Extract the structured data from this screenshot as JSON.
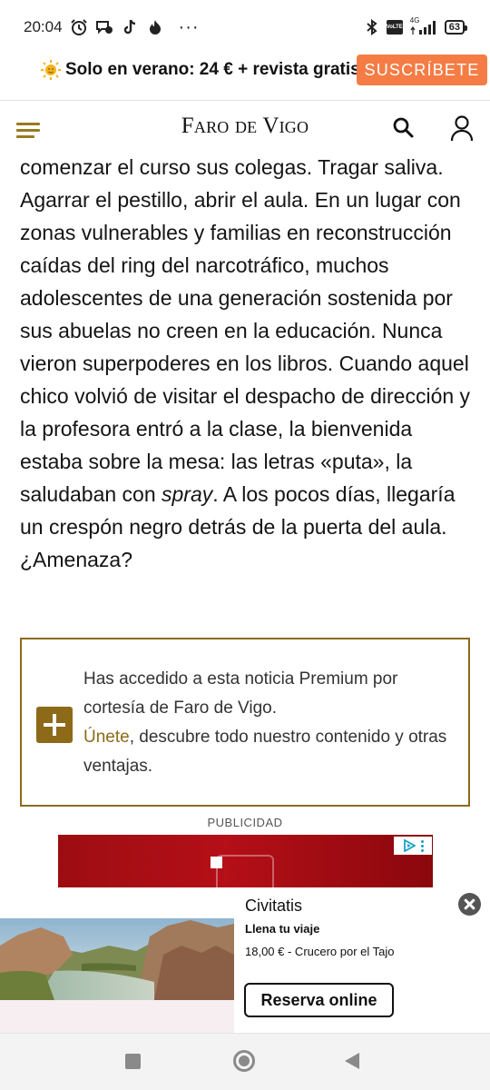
{
  "status_bar": {
    "time": "20:04",
    "battery": "63",
    "network": "4G",
    "volte": "VoLTE",
    "more": "···",
    "icons": [
      "alarm-icon",
      "chat-icon",
      "tiktok-icon",
      "flame-icon",
      "bluetooth-icon",
      "volte-icon",
      "signal-icon",
      "battery-icon"
    ]
  },
  "promo": {
    "icon": "sun-icon",
    "text": "Solo en verano: 24 € + revista gratis",
    "subscribe_label": "SUSCRÍBETE",
    "accent": "#f57c45"
  },
  "header": {
    "brand_first": "Faro",
    "brand_second": "de Vigo",
    "menu_icon": "hamburger-menu-icon",
    "search_icon": "search-icon",
    "user_icon": "user-icon",
    "accent": "#9a7a1f"
  },
  "article": {
    "text_before": "comenzar el curso sus colegas. Tragar saliva. Agarrar el pestillo, abrir el aula. En un lugar con zonas vulnerables y familias en reconstrucción caídas del ring del narcotráfico, muchos adolescentes de una generación sostenida por sus abuelas no creen en la educación. Nunca vieron superpoderes en los libros. Cuando aquel chico volvió de visitar el despacho de dirección y la profesora entró a la clase, la bienvenida estaba sobre la mesa: las letras «puta», la saludaban con ",
    "text_italic": "spray",
    "text_after": ". A los pocos días, llegaría un crespón negro detrás de la puerta del aula. ¿Amenaza?"
  },
  "premium": {
    "line1": "Has accedido a esta noticia Premium por cortesía de Faro de Vigo.",
    "link_label": "Únete",
    "line2": ", descubre todo nuestro contenido y otras ventajas.",
    "icon": "plus-icon",
    "border_color": "#8c6a18"
  },
  "advertising": {
    "label": "PUBLICIDAD",
    "banner_color": "#b50f18",
    "ad_choices_icon": "ad-choices-icon"
  },
  "sticky_ad": {
    "brand": "Civitatis",
    "headline": "Llena tu viaje",
    "price": "18,00 € - Crucero por el Tajo",
    "cta": "Reserva online",
    "close_icon": "close-icon"
  },
  "nav_bar": {
    "icons": [
      "recents-icon",
      "home-icon",
      "back-icon"
    ]
  }
}
